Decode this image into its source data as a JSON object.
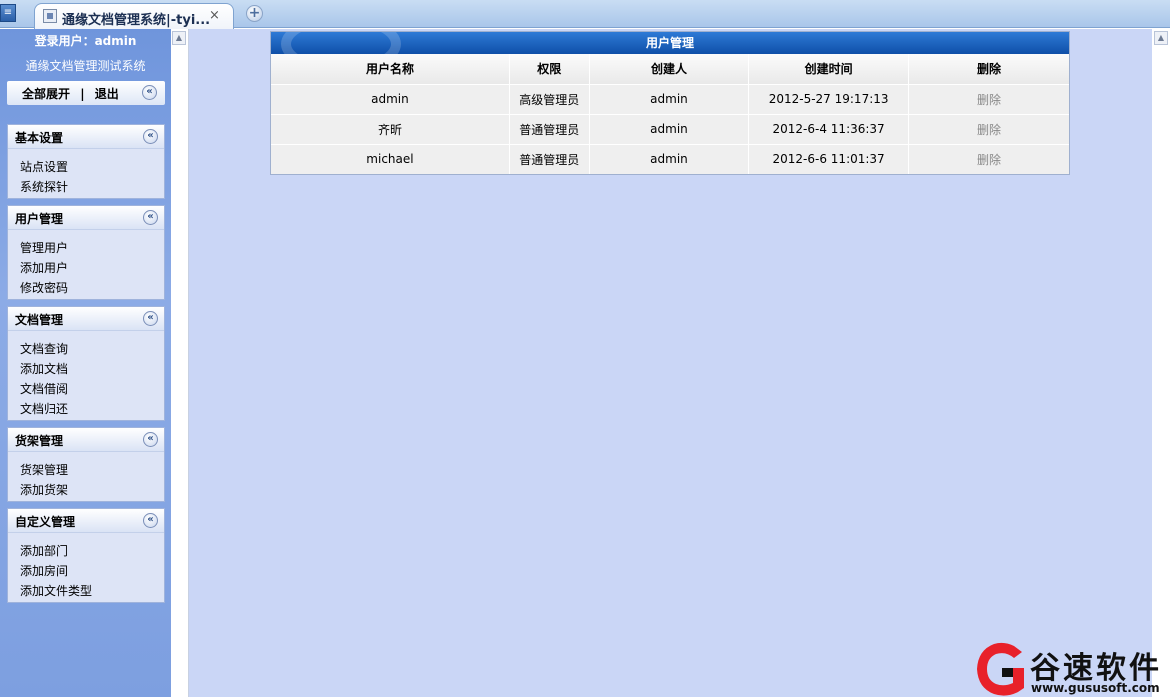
{
  "browser": {
    "tab_title": "通缘文档管理系统|-tyi...",
    "tab_close": "×",
    "new_tab_symbol": "+",
    "menu_symbol": "≡"
  },
  "sidebar": {
    "login_line": "登录用户：admin",
    "system_name": "通缘文档管理测试系统",
    "expand_all": "全部展开",
    "separator": "|",
    "logout": "退出",
    "collapse_symbol": "«",
    "panels": [
      {
        "title": "基本设置",
        "items": [
          "站点设置",
          "系统探针"
        ]
      },
      {
        "title": "用户管理",
        "items": [
          "管理用户",
          "添加用户",
          "修改密码"
        ]
      },
      {
        "title": "文档管理",
        "items": [
          "文档查询",
          "添加文档",
          "文档借阅",
          "文档归还"
        ]
      },
      {
        "title": "货架管理",
        "items": [
          "货架管理",
          "添加货架"
        ]
      },
      {
        "title": "自定义管理",
        "items": [
          "添加部门",
          "添加房间",
          "添加文件类型"
        ]
      }
    ]
  },
  "main": {
    "table_title": "用户管理",
    "columns": [
      "用户名称",
      "权限",
      "创建人",
      "创建时间",
      "删除"
    ],
    "rows": [
      {
        "name": "admin",
        "role": "高级管理员",
        "creator": "admin",
        "created": "2012-5-27 19:17:13",
        "action": "删除"
      },
      {
        "name": "齐昕",
        "role": "普通管理员",
        "creator": "admin",
        "created": "2012-6-4 11:36:37",
        "action": "删除"
      },
      {
        "name": "michael",
        "role": "普通管理员",
        "creator": "admin",
        "created": "2012-6-6 11:01:37",
        "action": "删除"
      }
    ]
  },
  "watermark": {
    "brand": "谷速软件",
    "url": "www.gususoft.com",
    "colors": {
      "red": "#e8212a",
      "dark": "#111111"
    }
  },
  "colors": {
    "sidebar_bg": "#7d9fe0",
    "main_bg": "#cad6f6",
    "table_header_blue": "#1a5fbb"
  }
}
